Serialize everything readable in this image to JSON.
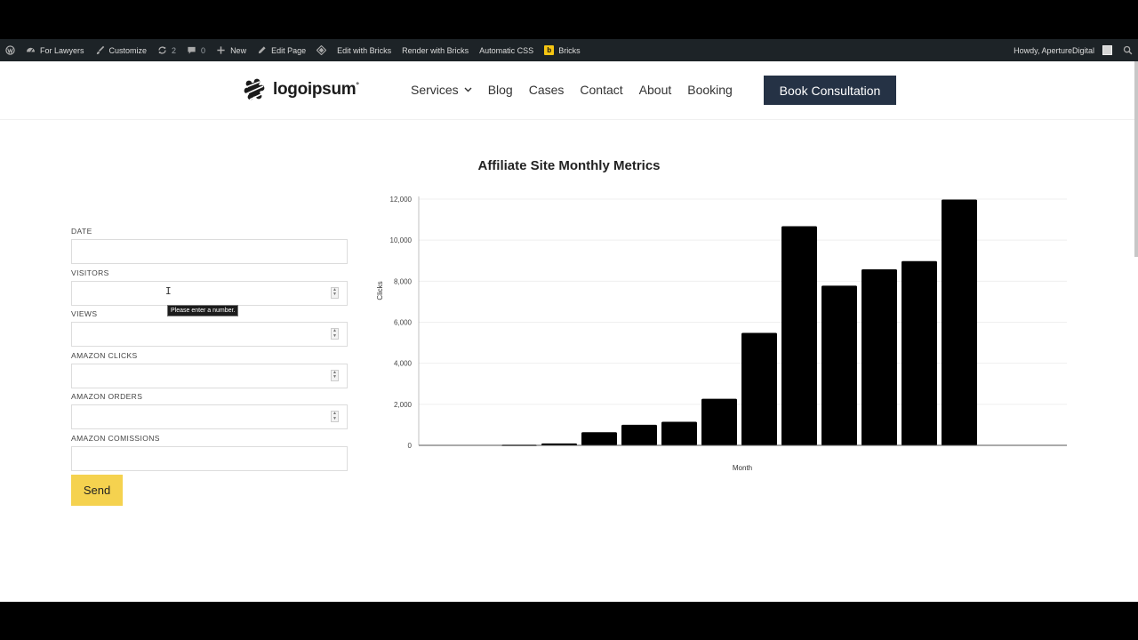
{
  "adminbar": {
    "items": [
      {
        "label": "For Lawyers",
        "icon": "dashboard-icon"
      },
      {
        "label": "Customize",
        "icon": "brush-icon"
      },
      {
        "label": "2",
        "icon": "updates-icon"
      },
      {
        "label": "0",
        "icon": "comment-icon"
      },
      {
        "label": "New",
        "icon": "plus-icon"
      },
      {
        "label": "Edit Page",
        "icon": "pencil-icon"
      },
      {
        "label": "Edit with Bricks"
      },
      {
        "label": "Render with Bricks"
      },
      {
        "label": "Automatic CSS"
      },
      {
        "label": "Bricks",
        "badge": "b"
      }
    ],
    "greeting": "Howdy, ApertureDigital"
  },
  "header": {
    "logo_text": "logoipsum",
    "logo_mark": "°",
    "nav": [
      "Services",
      "Blog",
      "Cases",
      "Contact",
      "About",
      "Booking"
    ],
    "cta": "Book Consultation"
  },
  "form": {
    "fields": [
      {
        "label": "DATE",
        "type": "text"
      },
      {
        "label": "VISITORS",
        "type": "number"
      },
      {
        "label": "VIEWS",
        "type": "number"
      },
      {
        "label": "AMAZON CLICKS",
        "type": "number"
      },
      {
        "label": "AMAZON ORDERS",
        "type": "number"
      },
      {
        "label": "AMAZON COMISSIONS",
        "type": "text"
      }
    ],
    "submit": "Send",
    "tooltip": "Please enter a number."
  },
  "chart_data": {
    "type": "bar",
    "title": "Affiliate Site Monthly Metrics",
    "xlabel": "Month",
    "ylabel": "Clicks",
    "ylim": [
      0,
      12000
    ],
    "yticks": [
      "0",
      "2,000",
      "4,000",
      "6,000",
      "8,000",
      "10,000",
      "12,000"
    ],
    "ytick_values": [
      0,
      2000,
      4000,
      6000,
      8000,
      10000,
      12000
    ],
    "values": [
      0,
      0,
      30,
      90,
      640,
      1000,
      1150,
      2270,
      5480,
      10680,
      7780,
      8580,
      8980,
      11980
    ],
    "bar_color": "#000000",
    "grid": true
  }
}
